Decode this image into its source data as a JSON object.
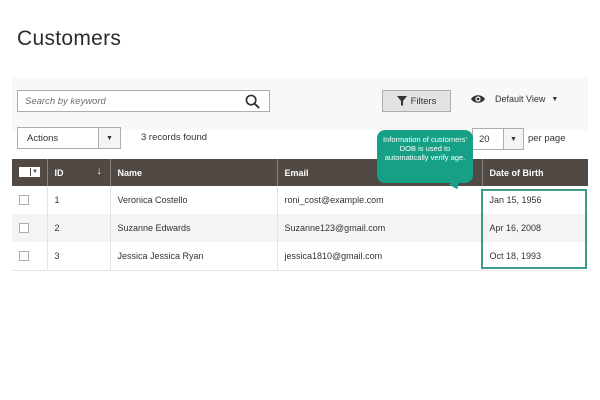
{
  "page": {
    "title": "Customers"
  },
  "toolbar": {
    "search_placeholder": "Search by keyword",
    "filters_label": "Filters",
    "view_label": "Default View",
    "actions_label": "Actions",
    "records_found": "3 records found",
    "per_page_value": "20",
    "per_page_label": "per page"
  },
  "table": {
    "columns": {
      "id": "ID",
      "name": "Name",
      "email": "Email",
      "dob": "Date of Birth"
    },
    "rows": [
      {
        "id": "1",
        "name": "Veronica Costello",
        "email": "roni_cost@example.com",
        "dob": "Jan 15, 1956"
      },
      {
        "id": "2",
        "name": "Suzanne Edwards",
        "email": "Suzanne123@gmail.com",
        "dob": "Apr 16, 2008"
      },
      {
        "id": "3",
        "name": "Jessica Jessica Ryan",
        "email": "jessica1810@gmail.com",
        "dob": "Oct 18, 1993"
      }
    ]
  },
  "callout": {
    "text": "Information of customers' DOB is used to automatically verify age."
  },
  "colors": {
    "header_bg": "#514943",
    "accent_teal": "#16a085",
    "highlight_border": "#3d9b8c"
  }
}
